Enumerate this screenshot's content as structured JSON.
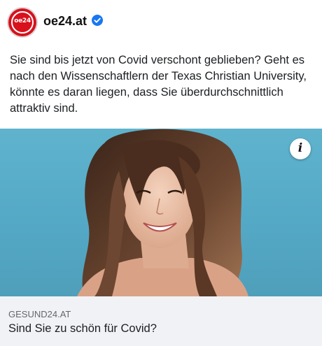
{
  "post": {
    "author": {
      "name": "oe24.at",
      "avatar_logo_text": "oe24",
      "verified_icon": "verified-badge-icon",
      "brand_color": "#d8111c"
    },
    "text": "Sie sind bis jetzt von Covid verschont geblieben? Geht es nach den Wissenschaftlern der Texas Christian University, könnte es daran liegen, dass Sie überdurchschnittlich attraktiv sind.",
    "image": {
      "description_icon": "info-icon",
      "info_glyph": "i",
      "background_color": "#57acc8"
    },
    "link": {
      "domain": "GESUND24.AT",
      "title": "Sind Sie zu schön für Covid?"
    }
  }
}
